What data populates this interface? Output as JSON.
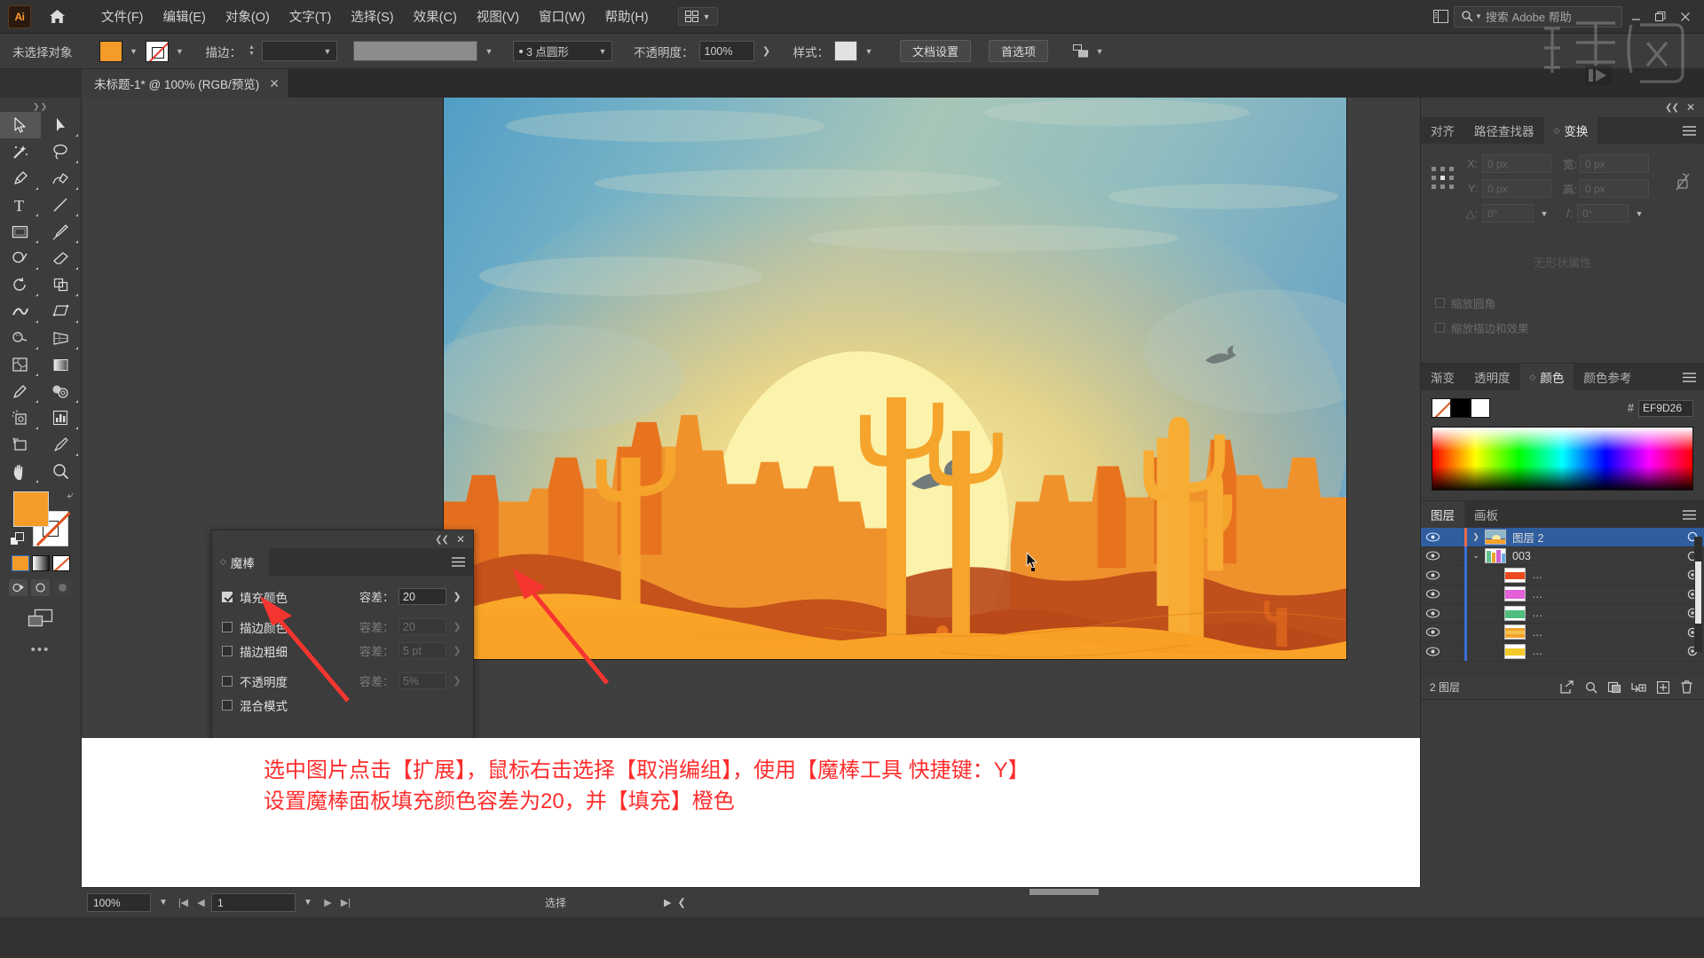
{
  "app": {
    "logo": "Ai",
    "menus": [
      "文件(F)",
      "编辑(E)",
      "对象(O)",
      "文字(T)",
      "选择(S)",
      "效果(C)",
      "视图(V)",
      "窗口(W)",
      "帮助(H)"
    ],
    "search_placeholder": "搜索 Adobe 帮助"
  },
  "controlbar": {
    "selection_status": "未选择对象",
    "fill_color": "#F59B28",
    "stroke_label": "描边：",
    "stroke_weight": "",
    "brush_label": "3 点圆形",
    "opacity_label": "不透明度：",
    "opacity_value": "100%",
    "style_label": "样式：",
    "doc_setup_button": "文档设置",
    "preferences_button": "首选项"
  },
  "tab": {
    "title": "未标题-1* @ 100% (RGB/预览)",
    "close": "✕"
  },
  "magic_wand_panel": {
    "title": "魔棒",
    "close": "✕",
    "rows": [
      {
        "label": "填充颜色",
        "checked": true,
        "tolerance_label": "容差：",
        "tolerance_value": "20"
      },
      {
        "label": "描边颜色",
        "checked": false,
        "tolerance_label": "容差：",
        "tolerance_value": "20"
      },
      {
        "label": "描边粗细",
        "checked": false,
        "tolerance_label": "容差：",
        "tolerance_value": "5 pt"
      },
      {
        "label": "不透明度",
        "checked": false,
        "tolerance_label": "容差：",
        "tolerance_value": "5%"
      },
      {
        "label": "混合模式",
        "checked": false,
        "tolerance_label": "",
        "tolerance_value": ""
      }
    ]
  },
  "transform_panel": {
    "tabs": [
      "对齐",
      "路径查找器",
      "变换"
    ],
    "active_tab": "变换",
    "fields": {
      "x_label": "X:",
      "x_value": "0 px",
      "y_label": "Y:",
      "y_value": "0 px",
      "w_label": "宽:",
      "w_value": "0 px",
      "h_label": "高:",
      "h_value": "0 px",
      "angle_label": "△:",
      "angle_value": "0°",
      "shear_label": "/:",
      "shear_value": "0°"
    },
    "checkbox_scale_corners": "缩放圆角",
    "checkbox_scale_strokes": "缩放描边和效果",
    "empty_text": "无形状属性"
  },
  "color_panel": {
    "tabs": [
      "渐变",
      "透明度",
      "颜色",
      "颜色参考"
    ],
    "active_tab": "颜色",
    "hash": "#",
    "hex_value": "EF9D26",
    "swatch_fill": "#EF9D26"
  },
  "layers_panel": {
    "tabs": [
      "图层",
      "画板"
    ],
    "active_tab": "图层",
    "rows": [
      {
        "name": "图层 2",
        "selected": true,
        "indent": 0,
        "color": "#f06a4d",
        "has_disclosure": true,
        "expanded": false,
        "thumb": "sunset"
      },
      {
        "name": "003",
        "selected": false,
        "indent": 1,
        "color": "#3a6fd8",
        "has_disclosure": true,
        "expanded": true,
        "thumb": "group"
      },
      {
        "name": "…",
        "selected": false,
        "indent": 2,
        "color": "#3a6fd8",
        "has_disclosure": false,
        "expanded": false,
        "thumb": "red"
      },
      {
        "name": "…",
        "selected": false,
        "indent": 2,
        "color": "#3a6fd8",
        "has_disclosure": false,
        "expanded": false,
        "thumb": "magenta"
      },
      {
        "name": "…",
        "selected": false,
        "indent": 2,
        "color": "#3a6fd8",
        "has_disclosure": false,
        "expanded": false,
        "thumb": "green"
      },
      {
        "name": "…",
        "selected": false,
        "indent": 2,
        "color": "#3a6fd8",
        "has_disclosure": false,
        "expanded": false,
        "thumb": "orange"
      },
      {
        "name": "…",
        "selected": false,
        "indent": 2,
        "color": "#3a6fd8",
        "has_disclosure": false,
        "expanded": false,
        "thumb": "yellow"
      }
    ],
    "footer_count": "2 图层"
  },
  "annotation": {
    "line1": "选中图片点击【扩展】，鼠标右击选择【取消编组】，使用【魔棒工具 快捷键：Y】",
    "line2": "设置魔棒面板填充颜色容差为20，并【填充】橙色",
    "color": "#FF2D2D"
  },
  "statusbar": {
    "zoom": "100%",
    "page": "1",
    "status_text": "选择"
  },
  "artwork": {
    "description": "沙漠日落插画",
    "colors": {
      "sky_top": "#5a9fc4",
      "sky_mid": "#9ec7c4",
      "sky_warm": "#e6c77a",
      "sun": "#fbf0a8",
      "mesa_light": "#f0922c",
      "mesa_mid": "#e8731f",
      "dune_dark": "#c4521a",
      "sand": "#f9a227",
      "cactus": "#f5a42c",
      "bird": "#6f7a7a"
    }
  }
}
